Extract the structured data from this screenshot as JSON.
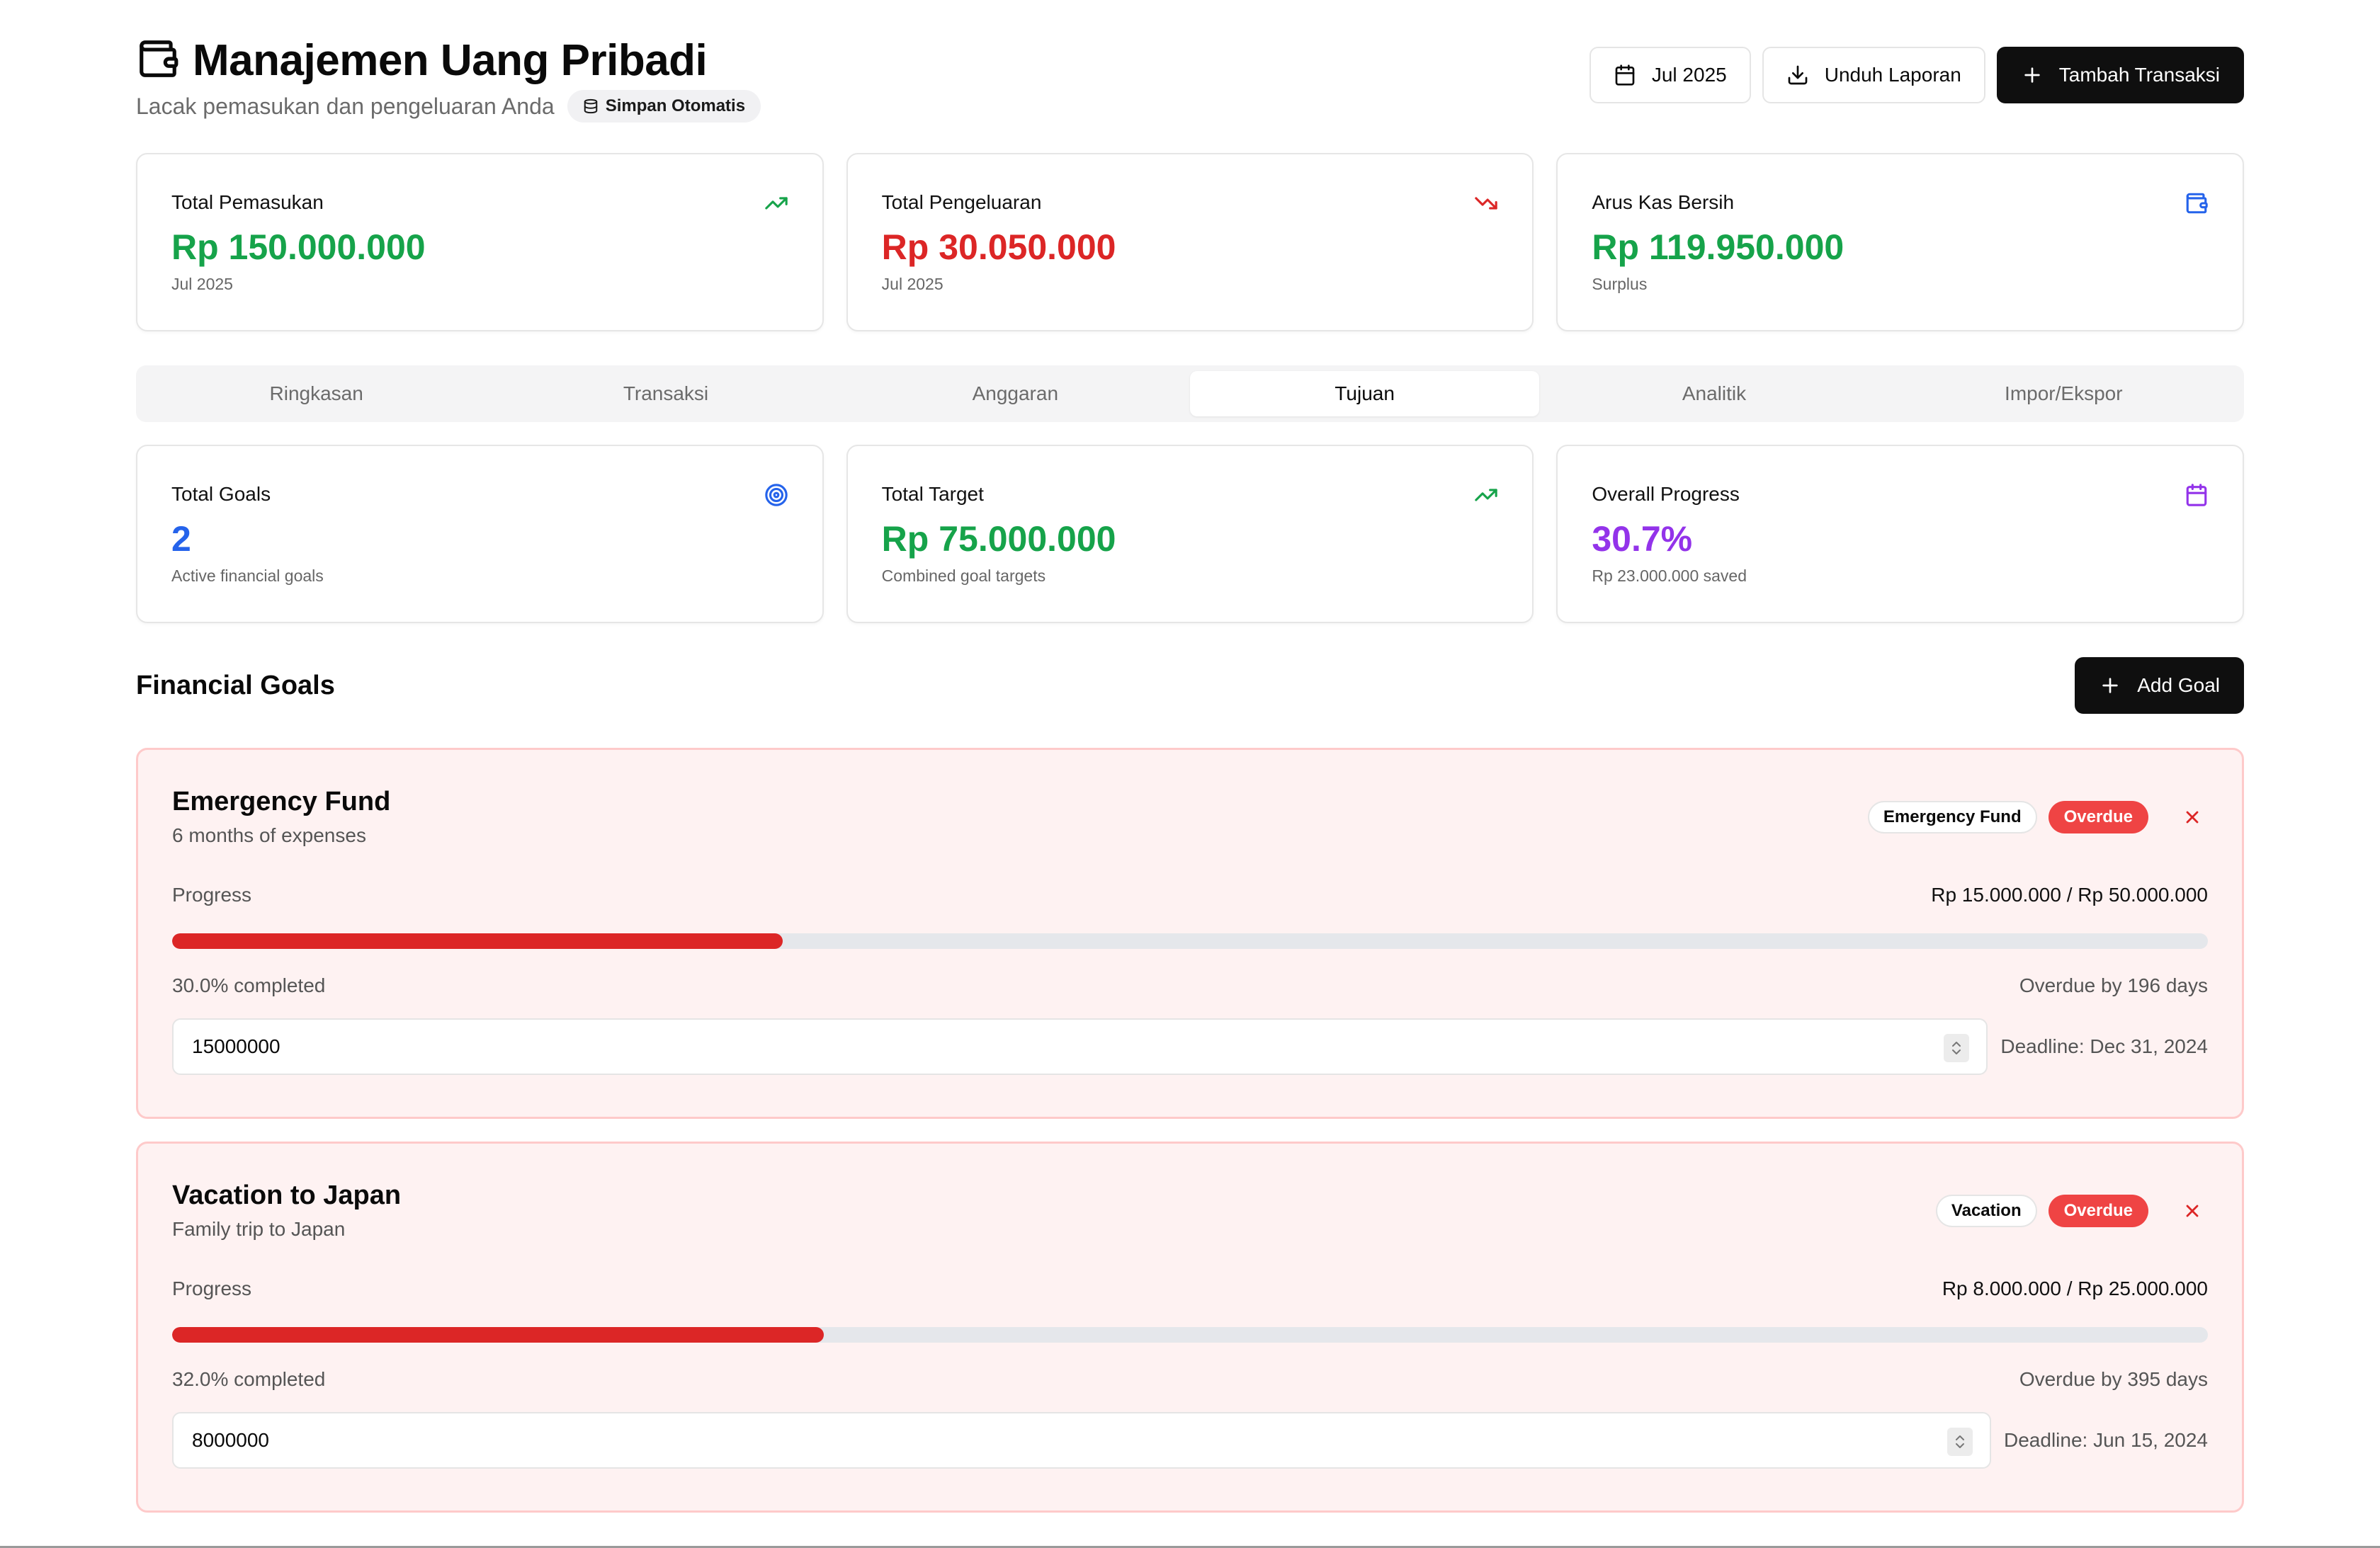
{
  "header": {
    "title": "Manajemen Uang Pribadi",
    "subtitle": "Lacak pemasukan dan pengeluaran Anda",
    "autosave_badge": "Simpan Otomatis",
    "month_button": "Jul 2025",
    "download_button": "Unduh Laporan",
    "add_transaction_button": "Tambah Transaksi"
  },
  "summary_cards": [
    {
      "label": "Total Pemasukan",
      "value": "Rp 150.000.000",
      "sub": "Jul 2025",
      "icon": "trending-up-icon",
      "color": "#16a34a"
    },
    {
      "label": "Total Pengeluaran",
      "value": "Rp 30.050.000",
      "sub": "Jul 2025",
      "icon": "trending-down-icon",
      "color": "#dc2626"
    },
    {
      "label": "Arus Kas Bersih",
      "value": "Rp 119.950.000",
      "sub": "Surplus",
      "icon": "wallet-icon",
      "color": "#16a34a"
    }
  ],
  "tabs": [
    {
      "label": "Ringkasan",
      "active": false
    },
    {
      "label": "Transaksi",
      "active": false
    },
    {
      "label": "Anggaran",
      "active": false
    },
    {
      "label": "Tujuan",
      "active": true
    },
    {
      "label": "Analitik",
      "active": false
    },
    {
      "label": "Impor/Ekspor",
      "active": false
    }
  ],
  "goal_stats": [
    {
      "label": "Total Goals",
      "value": "2",
      "sub": "Active financial goals",
      "icon": "target-icon",
      "color": "#2563eb"
    },
    {
      "label": "Total Target",
      "value": "Rp 75.000.000",
      "sub": "Combined goal targets",
      "icon": "trending-up-icon",
      "color": "#16a34a"
    },
    {
      "label": "Overall Progress",
      "value": "30.7%",
      "sub": "Rp 23.000.000 saved",
      "icon": "calendar-icon",
      "color": "#9333ea"
    }
  ],
  "goals_section": {
    "title": "Financial Goals",
    "add_button": "Add Goal"
  },
  "goals": [
    {
      "name": "Emergency Fund",
      "description": "6 months of expenses",
      "category": "Emergency Fund",
      "status": "Overdue",
      "progress_label": "Progress",
      "amount_text": "Rp 15.000.000 / Rp 50.000.000",
      "progress_fraction": 0.3,
      "completed_text": "30.0% completed",
      "overdue_text": "Overdue by 196 days",
      "input_value": "15000000",
      "deadline": "Deadline: Dec 31, 2024"
    },
    {
      "name": "Vacation to Japan",
      "description": "Family trip to Japan",
      "category": "Vacation",
      "status": "Overdue",
      "progress_label": "Progress",
      "amount_text": "Rp 8.000.000 / Rp 25.000.000",
      "progress_fraction": 0.32,
      "completed_text": "32.0% completed",
      "overdue_text": "Overdue by 395 days",
      "input_value": "8000000",
      "deadline": "Deadline: Jun 15, 2024"
    }
  ]
}
